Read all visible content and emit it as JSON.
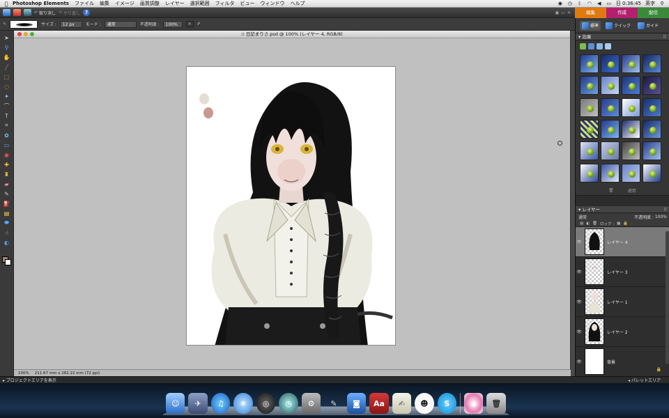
{
  "menubar": {
    "app_name": "Photoshop Elements",
    "menus": [
      "ファイル",
      "編集",
      "イメージ",
      "画質調整",
      "レイヤー",
      "選択範囲",
      "フィルタ",
      "ビュー",
      "ウィンドウ",
      "ヘルプ"
    ],
    "time": "日 0:36:45",
    "input_method": "英字"
  },
  "app_toolbar": {
    "undo_label": "取り消し",
    "redo_label": "やり直し",
    "help_label": "?"
  },
  "mode_tabs": [
    {
      "label": "編集",
      "color": "#e07a10"
    },
    {
      "label": "作成",
      "color": "#b4206e"
    },
    {
      "label": "配信",
      "color": "#3a8a3a"
    }
  ],
  "options_bar": {
    "size_label": "サイズ :",
    "size_value": "12 px",
    "mode_label": "モード :",
    "mode_value": "通常",
    "opacity_label": "不透明度 :",
    "opacity_value": "100%"
  },
  "document": {
    "title": "日記まりさ.psd @ 100% (レイヤー 4, RGB/8)",
    "zoom": "100%",
    "dimensions": "211.67 mm x 282.22 mm (72 ppi)"
  },
  "subtabs": [
    {
      "label": "標準",
      "active": true
    },
    {
      "label": "クイック",
      "active": false
    },
    {
      "label": "ガイド",
      "active": false
    }
  ],
  "effects_panel": {
    "title": "効果",
    "apply_label": "適用"
  },
  "layers_panel": {
    "title": "レイヤー",
    "blend_mode": "通常",
    "opacity_label": "不透明度 :",
    "opacity_value": "100%",
    "lock_label": "ロック :",
    "layers": [
      {
        "name": "レイヤー 4",
        "selected": true
      },
      {
        "name": "レイヤー 3",
        "selected": false
      },
      {
        "name": "レイヤー 1",
        "selected": false
      },
      {
        "name": "レイヤー 2",
        "selected": false
      },
      {
        "name": "背景",
        "selected": false
      }
    ]
  },
  "project_bar": {
    "left_label": "プロジェクトエリアを表示",
    "right_label": "パレットエリア"
  },
  "colors": {
    "foreground": "#a88378",
    "background": "#ffffff"
  }
}
